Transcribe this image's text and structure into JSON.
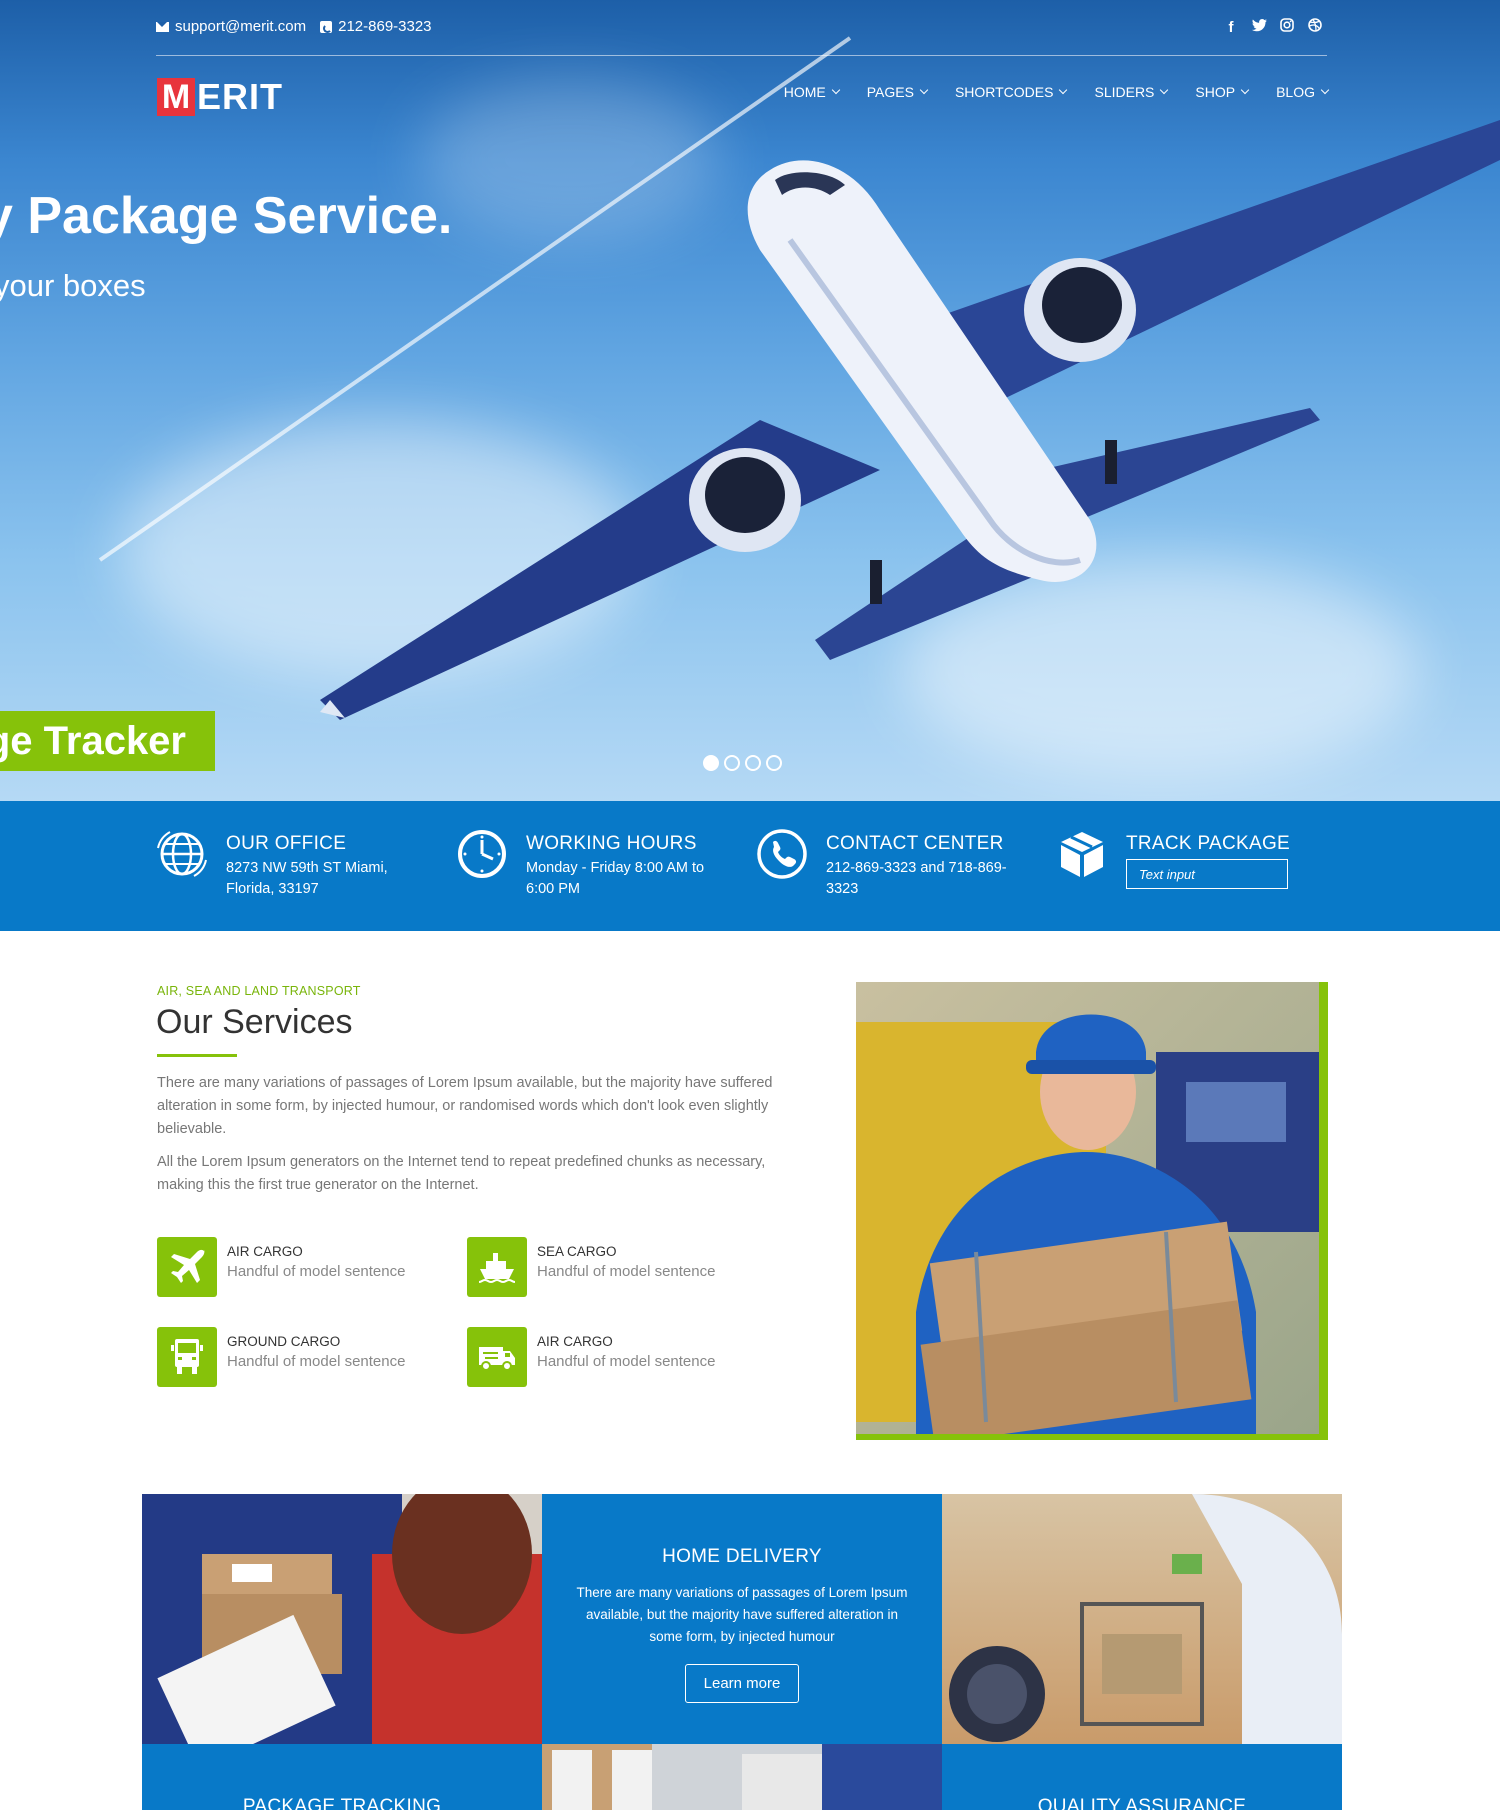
{
  "topbar": {
    "email": "support@merit.com",
    "phone": "212-869-3323",
    "social": [
      "facebook-icon",
      "twitter-icon",
      "instagram-icon",
      "dribbble-icon"
    ]
  },
  "logo": {
    "first": "M",
    "rest": "ERIT"
  },
  "nav": {
    "items": [
      {
        "label": "HOME"
      },
      {
        "label": "PAGES"
      },
      {
        "label": "SHORTCODES"
      },
      {
        "label": "SLIDERS"
      },
      {
        "label": "SHOP"
      },
      {
        "label": "BLOG"
      }
    ]
  },
  "hero": {
    "title": "y Package Service.",
    "subtitle": "your boxes",
    "button": "ge Tracker",
    "slides": 4,
    "active_slide": 1
  },
  "infobar": {
    "office": {
      "title": "OUR OFFICE",
      "line1": "8273 NW 59th ST Miami,",
      "line2": "Florida, 33197"
    },
    "hours": {
      "title": "WORKING HOURS",
      "line1": "Monday - Friday 8:00 AM to",
      "line2": "6:00 PM"
    },
    "contact": {
      "title": "CONTACT CENTER",
      "line1": "212-869-3323 and 718-869-",
      "line2": "3323"
    },
    "track": {
      "title": "TRACK PACKAGE",
      "placeholder": "Text input"
    }
  },
  "services": {
    "eyebrow": "AIR, SEA AND LAND TRANSPORT",
    "title": "Our Services",
    "p1": "There are many variations of passages of Lorem Ipsum available, but the majority have suffered alteration in some form, by injected humour, or randomised words which don't look even slightly believable.",
    "p2": "All the Lorem Ipsum generators on the Internet tend to repeat predefined chunks as necessary, making this the first true generator on the Internet.",
    "features": [
      {
        "label": "AIR CARGO",
        "desc": "Handful of model sentence",
        "icon": "airplane-icon"
      },
      {
        "label": "SEA CARGO",
        "desc": "Handful of model sentence",
        "icon": "ship-icon"
      },
      {
        "label": "GROUND CARGO",
        "desc": "Handful of model sentence",
        "icon": "truck-icon"
      },
      {
        "label": "AIR CARGO",
        "desc": "Handful of model sentence",
        "icon": "van-icon"
      }
    ]
  },
  "tiles": {
    "home_delivery": {
      "title": "HOME DELIVERY",
      "text": "There are many variations of passages of Lorem Ipsum available, but the majority have suffered alteration in some form, by injected humour",
      "button": "Learn more"
    },
    "package_tracking": {
      "title": "PACKAGE TRACKING"
    },
    "quality_assurance": {
      "title": "QUALITY ASSURANCE"
    }
  },
  "colors": {
    "blue": "#0879c8",
    "green": "#86c20a",
    "logo_red": "#e8343c"
  }
}
